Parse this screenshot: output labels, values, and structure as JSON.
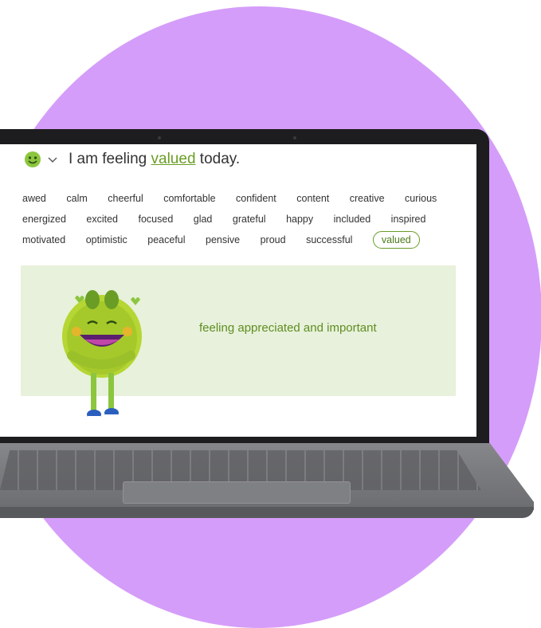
{
  "background": {
    "circle_color": "#d59dfa"
  },
  "header": {
    "emoji": "smiling-face-icon",
    "prefix": "I am feeling",
    "selected_word": "valued",
    "suffix": "today."
  },
  "feelings": [
    "awed",
    "calm",
    "cheerful",
    "comfortable",
    "confident",
    "content",
    "creative",
    "curious",
    "energized",
    "excited",
    "focused",
    "glad",
    "grateful",
    "happy",
    "included",
    "inspired",
    "motivated",
    "optimistic",
    "peaceful",
    "pensive",
    "proud",
    "successful",
    "valued"
  ],
  "selected_feeling": "valued",
  "definition": "feeling appreciated and important",
  "colors": {
    "accent": "#6a9d26",
    "panel": "#e8f1db"
  }
}
